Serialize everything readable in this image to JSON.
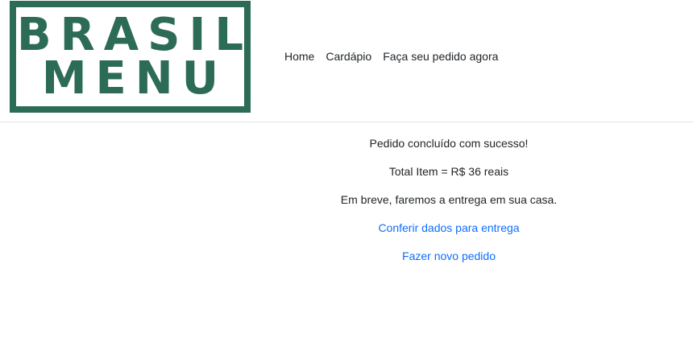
{
  "logo": {
    "line1": "BRASIL",
    "line2": "MENU",
    "color": "#2c6b56"
  },
  "nav": {
    "items": [
      "Home",
      "Cardápio",
      "Faça seu pedido agora"
    ]
  },
  "confirmation": {
    "success_message": "Pedido concluído com sucesso!",
    "total_text": "Total Item = R$ 36 reais",
    "delivery_message": "Em breve, faremos a entrega em sua casa.",
    "check_delivery_link": "Conferir dados para entrega",
    "new_order_link": "Fazer novo pedido",
    "link_color": "#0d6efd"
  }
}
